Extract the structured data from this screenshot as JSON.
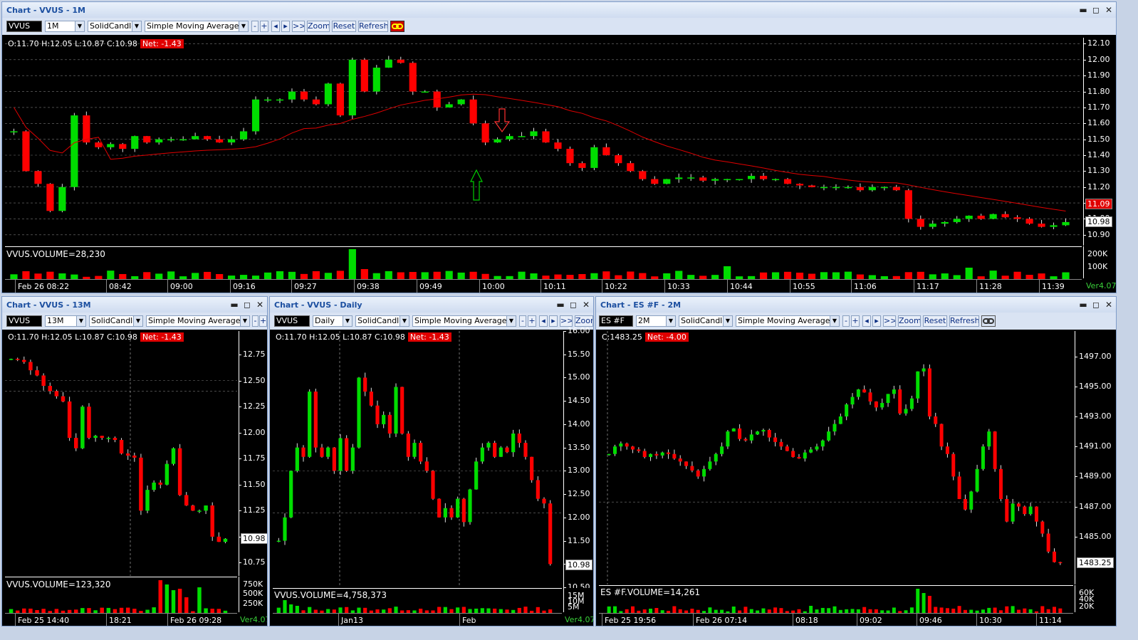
{
  "colors": {
    "up": "#00dd00",
    "down": "#ff0000",
    "sma": "#e00000",
    "grid": "#777777"
  },
  "main": {
    "title": "Chart - VVUS - 1M",
    "symbol": "VVUS",
    "interval": "1M",
    "style": "SolidCandle",
    "indicator": "Simple Moving Average",
    "buttons": {
      "minus": "-",
      "plus": "+",
      "prev": "◂",
      "next": "▸",
      "end": ">>|",
      "zoom": "Zoom",
      "reset": "Reset",
      "refresh": "Refresh"
    },
    "ohlc": "O:11.70  H:12.05  L:10.87  C:10.98",
    "net": "Net: -1.43",
    "yticks": [
      "12.10",
      "12.00",
      "11.90",
      "11.80",
      "11.70",
      "11.60",
      "11.50",
      "11.40",
      "11.30",
      "11.20",
      "11.10",
      "11.00",
      "10.90"
    ],
    "sma_label": "11.09",
    "price_label": "10.98",
    "volume_label": "VVUS.VOLUME=28,230",
    "volticks": [
      "200K",
      "100K"
    ],
    "xlabels": [
      "Feb 26 08:22",
      "08:42",
      "09:00",
      "09:16",
      "09:27",
      "09:38",
      "09:49",
      "10:00",
      "10:11",
      "10:22",
      "10:33",
      "10:44",
      "10:55",
      "11:06",
      "11:17",
      "11:28",
      "11:39"
    ],
    "version": "Ver4.07"
  },
  "w13": {
    "title": "Chart - VVUS - 13M",
    "symbol": "VVUS",
    "interval": "13M",
    "style": "SolidCandle",
    "indicator": "Simple Moving Average",
    "ohlc": "O:11.70  H:12.05  L:10.87  C:10.98",
    "net": "Net: -1.43",
    "yticks": [
      "12.75",
      "12.50",
      "12.25",
      "12.00",
      "11.75",
      "11.50",
      "11.25",
      "11.00",
      "10.75"
    ],
    "price_label": "10.98",
    "volume_label": "VVUS.VOLUME=123,320",
    "volticks": [
      "750K",
      "500K",
      "250K"
    ],
    "xlabels": [
      "Feb 25 14:40",
      "18:21",
      "Feb 26 09:28"
    ],
    "version": "Ver4.07"
  },
  "daily": {
    "title": "Chart - VVUS - Daily",
    "symbol": "VVUS",
    "interval": "Daily",
    "style": "SolidCandle",
    "indicator": "Simple Moving Average",
    "ohlc": "O:11.70  H:12.05  L:10.87  C:10.98",
    "net": "Net: -1.43",
    "yticks": [
      "16.00",
      "15.50",
      "15.00",
      "14.50",
      "14.00",
      "13.50",
      "13.00",
      "12.50",
      "12.00",
      "11.50",
      "11.00",
      "10.50"
    ],
    "price_label": "10.98",
    "volume_label": "VVUS.VOLUME=4,758,373",
    "volticks": [
      "15M",
      "10M",
      "5M"
    ],
    "xlabels": [
      "Jan13",
      "Feb"
    ],
    "version": "Ver4.07"
  },
  "es": {
    "title": "Chart - ES #F - 2M",
    "symbol": "ES #F",
    "interval": "2M",
    "style": "SolidCandle",
    "indicator": "Simple Moving Average",
    "ohlc": "C:1483.25",
    "net": "Net: -4.00",
    "yticks": [
      "1497.00",
      "1495.00",
      "1493.00",
      "1491.00",
      "1489.00",
      "1487.00",
      "1485.00"
    ],
    "price_label": "1483.25",
    "volume_label": "ES #F.VOLUME=14,261",
    "volticks": [
      "60K",
      "40K",
      "20K"
    ],
    "xlabels": [
      "Feb 25 19:56",
      "Feb 26 07:14",
      "08:18",
      "09:02",
      "09:46",
      "10:30",
      "11:14"
    ]
  },
  "chart_data": [
    {
      "type": "candlestick",
      "symbol": "VVUS",
      "interval": "1M",
      "ylim": [
        10.85,
        12.12
      ],
      "close": [
        11.55,
        11.3,
        11.22,
        11.05,
        11.2,
        11.65,
        11.48,
        11.45,
        11.47,
        11.44,
        11.52,
        11.48,
        11.5,
        11.5,
        11.5,
        11.52,
        11.5,
        11.48,
        11.5,
        11.55,
        11.75,
        11.75,
        11.75,
        11.8,
        11.75,
        11.72,
        11.85,
        11.65,
        12.0,
        11.8,
        11.95,
        12.0,
        11.98,
        11.8,
        11.8,
        11.7,
        11.72,
        11.75,
        11.6,
        11.48,
        11.5,
        11.52,
        11.52,
        11.55,
        11.48,
        11.44,
        11.35,
        11.32,
        11.45,
        11.4,
        11.35,
        11.3,
        11.25,
        11.22,
        11.25,
        11.26,
        11.26,
        11.24,
        11.25,
        11.25,
        11.25,
        11.27,
        11.25,
        11.25,
        11.22,
        11.21,
        11.2,
        11.2,
        11.2,
        11.2,
        11.18,
        11.2,
        11.2,
        11.18,
        11.0,
        10.95,
        10.97,
        10.98,
        11.0,
        11.02,
        11.0,
        11.03,
        11.01,
        11.0,
        10.97,
        10.95,
        10.96,
        10.98
      ],
      "sma_last": 11.09,
      "volume_max": 250000
    },
    {
      "type": "candlestick",
      "symbol": "VVUS",
      "interval": "13M",
      "ylim": [
        10.65,
        12.95
      ],
      "close": [
        12.71,
        12.7,
        12.68,
        12.6,
        12.55,
        12.45,
        12.4,
        12.35,
        12.3,
        11.95,
        11.85,
        12.25,
        11.95,
        11.97,
        11.95,
        11.95,
        11.93,
        11.8,
        11.78,
        11.76,
        11.25,
        11.45,
        11.52,
        11.5,
        11.7,
        11.85,
        11.4,
        11.3,
        11.25,
        11.25,
        11.3,
        11.0,
        10.95,
        10.98
      ],
      "volume_max": 800000
    },
    {
      "type": "candlestick",
      "symbol": "VVUS",
      "interval": "Daily",
      "ylim": [
        10.5,
        16.0
      ],
      "close": [
        11.5,
        12.0,
        13.0,
        13.5,
        13.3,
        14.7,
        13.5,
        13.3,
        13.5,
        13.0,
        13.7,
        13.0,
        13.5,
        15.0,
        14.7,
        14.4,
        14.0,
        14.2,
        13.8,
        14.8,
        13.8,
        13.3,
        13.6,
        13.2,
        13.0,
        12.4,
        12.0,
        12.2,
        12.0,
        12.4,
        11.9,
        12.6,
        13.2,
        13.5,
        13.6,
        13.3,
        13.5,
        13.4,
        13.8,
        13.6,
        13.3,
        12.8,
        12.4,
        12.3,
        11.0
      ],
      "volume_max": 15000000
    },
    {
      "type": "candlestick",
      "symbol": "ES #F",
      "interval": "2M",
      "ylim": [
        1482.0,
        1498.5
      ],
      "close": [
        1490.5,
        1491.0,
        1491.2,
        1491.0,
        1490.8,
        1490.7,
        1490.3,
        1490.5,
        1490.4,
        1490.6,
        1490.5,
        1490.2,
        1490.0,
        1489.7,
        1489.4,
        1489.0,
        1489.5,
        1490.0,
        1490.5,
        1491.0,
        1492.0,
        1492.2,
        1491.5,
        1491.4,
        1491.8,
        1492.0,
        1492.1,
        1491.6,
        1491.3,
        1491.0,
        1490.7,
        1490.3,
        1490.2,
        1490.6,
        1490.8,
        1491.0,
        1491.4,
        1492.0,
        1492.5,
        1493.0,
        1493.8,
        1494.3,
        1494.8,
        1494.6,
        1494.0,
        1493.6,
        1493.9,
        1494.5,
        1494.8,
        1493.2,
        1493.5,
        1494.2,
        1496.0,
        1496.2,
        1493.0,
        1492.5,
        1491.0,
        1490.5,
        1489.0,
        1487.5,
        1486.8,
        1488.0,
        1489.5,
        1491.0,
        1492.0,
        1489.5,
        1487.5,
        1486.0,
        1487.2,
        1487.0,
        1486.5,
        1487.0,
        1486.0,
        1485.2,
        1484.0,
        1483.3,
        1483.25
      ],
      "volume_max": 60000
    }
  ]
}
